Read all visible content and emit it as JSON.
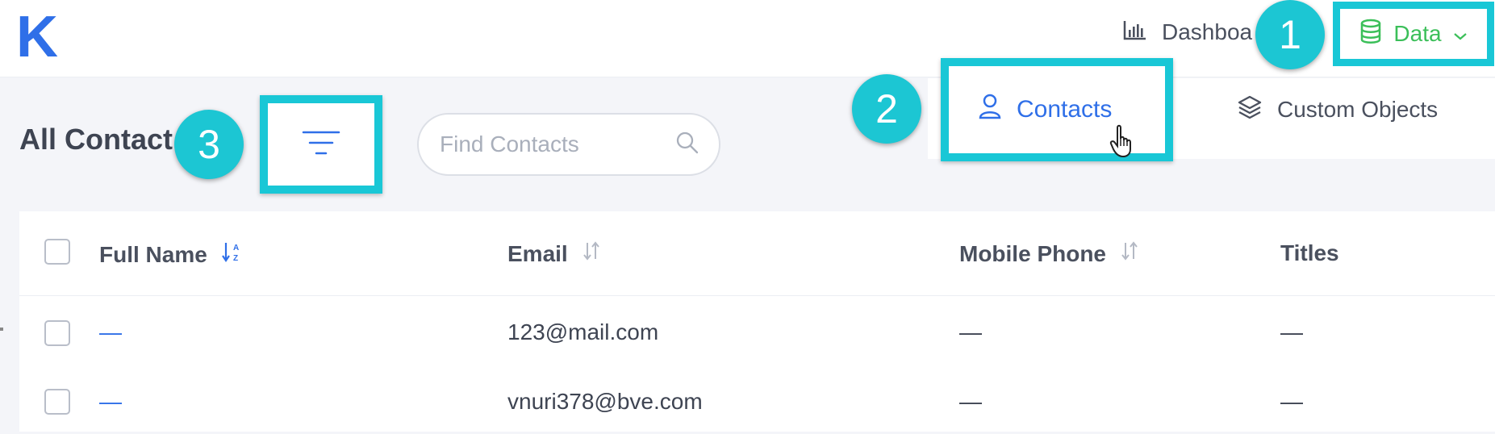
{
  "app": {
    "logo": "K"
  },
  "nav": {
    "dashboard_label": "Dashboa",
    "data_label": "Data"
  },
  "subnav": {
    "contacts_label": "Contacts",
    "custom_objects_label": "Custom Objects"
  },
  "badges": {
    "one": "1",
    "two": "2",
    "three": "3"
  },
  "page": {
    "title": "All Contact"
  },
  "search": {
    "placeholder": "Find Contacts",
    "value": ""
  },
  "table": {
    "columns": [
      "Full Name",
      "Email",
      "Mobile Phone",
      "Titles"
    ],
    "rows": [
      {
        "full_name": "—",
        "email": "123@mail.com",
        "mobile_phone": "—",
        "titles": "—"
      },
      {
        "full_name": "—",
        "email": "vnuri378@bve.com",
        "mobile_phone": "—",
        "titles": "—"
      }
    ]
  },
  "colors": {
    "accent_blue": "#2f6fe8",
    "data_green": "#3bbf59",
    "highlight_cyan": "#19c7d6",
    "badge_cyan": "#1cc6d3"
  },
  "icons": {
    "dashboard": "bar-chart-icon",
    "data": "database-icon",
    "contacts": "person-icon",
    "custom_objects": "layers-icon",
    "filter": "filter-lines-icon",
    "search": "search-icon",
    "cursor": "hand-pointer-icon"
  }
}
